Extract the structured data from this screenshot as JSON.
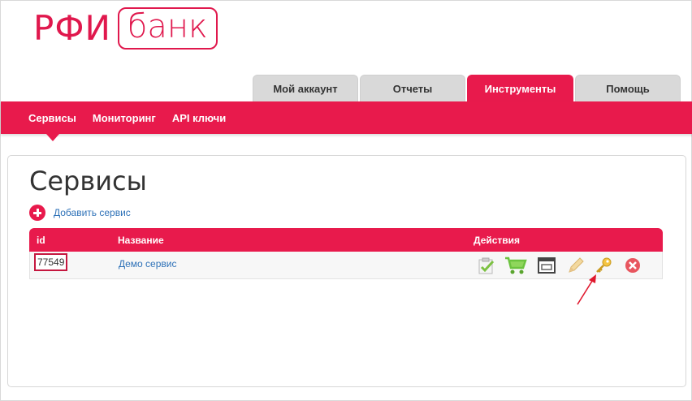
{
  "logo": {
    "part1": "РФИ",
    "part2": "банк"
  },
  "tabs": [
    {
      "label": "Мой аккаунт"
    },
    {
      "label": "Отчеты"
    },
    {
      "label": "Инструменты"
    },
    {
      "label": "Помощь"
    }
  ],
  "subnav": [
    {
      "label": "Сервисы"
    },
    {
      "label": "Мониторинг"
    },
    {
      "label": "API ключи"
    }
  ],
  "page": {
    "title": "Сервисы",
    "add_label": "Добавить сервис"
  },
  "table": {
    "headers": {
      "id": "id",
      "name": "Название",
      "actions": "Действия"
    },
    "rows": [
      {
        "id": "77549",
        "name": "Демо сервис"
      }
    ]
  },
  "colors": {
    "brand": "#e81a4c",
    "link": "#2f72b8"
  },
  "icons": [
    "checklist-icon",
    "cart-icon",
    "window-icon",
    "pencil-icon",
    "key-icon",
    "delete-icon"
  ]
}
